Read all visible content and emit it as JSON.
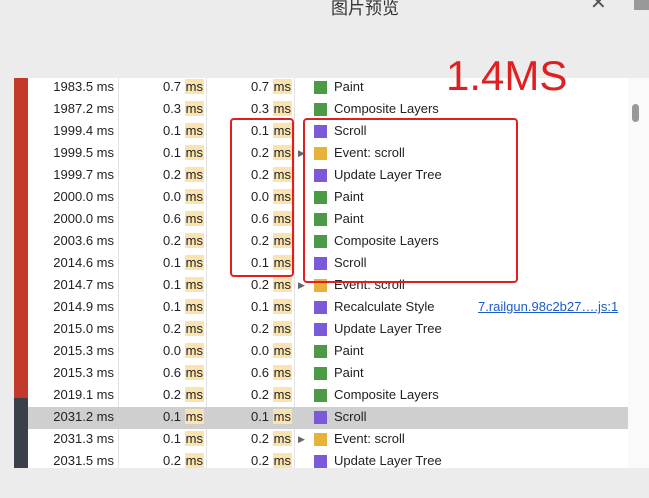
{
  "window": {
    "title": "图片预览"
  },
  "annotation": {
    "label": "1.4MS"
  },
  "colors": {
    "paint": "#4c9a46",
    "composite": "#4c9a46",
    "scroll": "#7a5ad6",
    "event": "#e6b23a",
    "update": "#7a5ad6",
    "recalc": "#7a5ad6"
  },
  "rows": [
    {
      "start": "1983.5 ms",
      "self": "0.7 ms",
      "total": "0.7 ms",
      "activity": "Paint",
      "color": "#4c9a46",
      "expand": false,
      "link": ""
    },
    {
      "start": "1987.2 ms",
      "self": "0.3 ms",
      "total": "0.3 ms",
      "activity": "Composite Layers",
      "color": "#4c9a46",
      "expand": false,
      "link": ""
    },
    {
      "start": "1999.4 ms",
      "self": "0.1 ms",
      "total": "0.1 ms",
      "activity": "Scroll",
      "color": "#7a5ad6",
      "expand": false,
      "link": ""
    },
    {
      "start": "1999.5 ms",
      "self": "0.1 ms",
      "total": "0.2 ms",
      "activity": "Event: scroll",
      "color": "#e6b23a",
      "expand": true,
      "link": ""
    },
    {
      "start": "1999.7 ms",
      "self": "0.2 ms",
      "total": "0.2 ms",
      "activity": "Update Layer Tree",
      "color": "#7a5ad6",
      "expand": false,
      "link": ""
    },
    {
      "start": "2000.0 ms",
      "self": "0.0 ms",
      "total": "0.0 ms",
      "activity": "Paint",
      "color": "#4c9a46",
      "expand": false,
      "link": ""
    },
    {
      "start": "2000.0 ms",
      "self": "0.6 ms",
      "total": "0.6 ms",
      "activity": "Paint",
      "color": "#4c9a46",
      "expand": false,
      "link": ""
    },
    {
      "start": "2003.6 ms",
      "self": "0.2 ms",
      "total": "0.2 ms",
      "activity": "Composite Layers",
      "color": "#4c9a46",
      "expand": false,
      "link": ""
    },
    {
      "start": "2014.6 ms",
      "self": "0.1 ms",
      "total": "0.1 ms",
      "activity": "Scroll",
      "color": "#7a5ad6",
      "expand": false,
      "link": ""
    },
    {
      "start": "2014.7 ms",
      "self": "0.1 ms",
      "total": "0.2 ms",
      "activity": "Event: scroll",
      "color": "#e6b23a",
      "expand": true,
      "link": ""
    },
    {
      "start": "2014.9 ms",
      "self": "0.1 ms",
      "total": "0.1 ms",
      "activity": "Recalculate Style",
      "color": "#7a5ad6",
      "expand": false,
      "link": "7.railgun.98c2b27….js:1"
    },
    {
      "start": "2015.0 ms",
      "self": "0.2 ms",
      "total": "0.2 ms",
      "activity": "Update Layer Tree",
      "color": "#7a5ad6",
      "expand": false,
      "link": ""
    },
    {
      "start": "2015.3 ms",
      "self": "0.0 ms",
      "total": "0.0 ms",
      "activity": "Paint",
      "color": "#4c9a46",
      "expand": false,
      "link": ""
    },
    {
      "start": "2015.3 ms",
      "self": "0.6 ms",
      "total": "0.6 ms",
      "activity": "Paint",
      "color": "#4c9a46",
      "expand": false,
      "link": ""
    },
    {
      "start": "2019.1 ms",
      "self": "0.2 ms",
      "total": "0.2 ms",
      "activity": "Composite Layers",
      "color": "#4c9a46",
      "expand": false,
      "link": ""
    },
    {
      "start": "2031.2 ms",
      "self": "0.1 ms",
      "total": "0.1 ms",
      "activity": "Scroll",
      "color": "#7a5ad6",
      "expand": false,
      "link": "",
      "selected": true
    },
    {
      "start": "2031.3 ms",
      "self": "0.1 ms",
      "total": "0.2 ms",
      "activity": "Event: scroll",
      "color": "#e6b23a",
      "expand": true,
      "link": ""
    },
    {
      "start": "2031.5 ms",
      "self": "0.2 ms",
      "total": "0.2 ms",
      "activity": "Update Layer Tree",
      "color": "#7a5ad6",
      "expand": false,
      "link": ""
    }
  ]
}
